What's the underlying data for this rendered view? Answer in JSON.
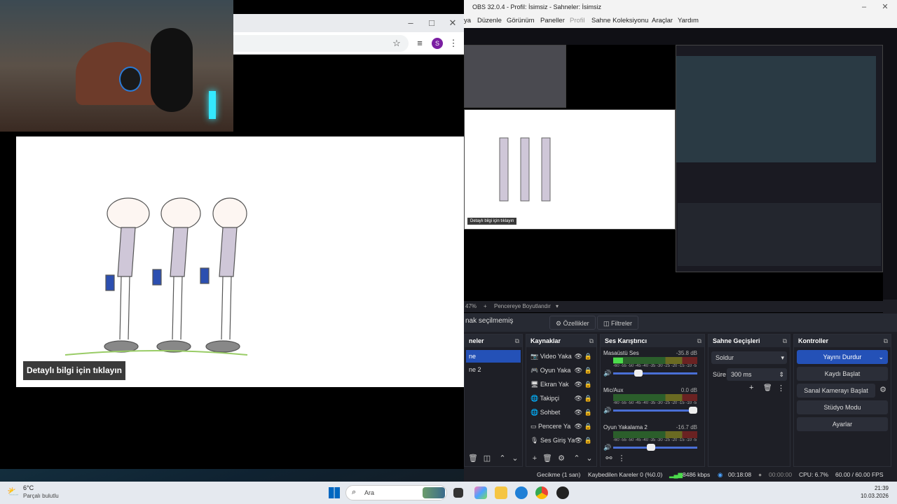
{
  "browser": {
    "toolbar_icons": [
      "star-icon",
      "playlist-icon",
      "menu-icon"
    ],
    "avatar_letter": "S",
    "window_controls": [
      "–",
      "□",
      "✕"
    ],
    "cta": "Detaylı bilgi için tıklayın"
  },
  "obs": {
    "title": "OBS 32.0.4 - Profil: İsimsiz - Sahneler: İsimsiz",
    "menu": [
      "ya",
      "Düzenle",
      "Görünüm",
      "Paneller",
      "Profil",
      "Sahne Koleksiyonu",
      "Araçlar",
      "Yardım"
    ],
    "window_controls": [
      "–",
      "□",
      "✕"
    ],
    "preview_caption": "Detaylı bilgi için tıklayın",
    "zoom": "47%",
    "zoom_mode": "Pencereye Boyutlandır",
    "source_status": "nak seçilmemiş",
    "properties_button": "Özellikler",
    "filters_button": "Filtreler",
    "scenes": {
      "title": "neler",
      "items": [
        "ne",
        "ne 2"
      ]
    },
    "sources": {
      "title": "Kaynaklar",
      "items": [
        {
          "label": "Video Yaka",
          "icon": "camera-icon"
        },
        {
          "label": "Oyun Yaka",
          "icon": "gamepad-icon"
        },
        {
          "label": "Ekran Yak",
          "icon": "monitor-icon"
        },
        {
          "label": "Takipçi",
          "icon": "globe-icon"
        },
        {
          "label": "Sohbet",
          "icon": "globe-icon"
        },
        {
          "label": "Pencere Ya",
          "icon": "window-icon"
        },
        {
          "label": "Ses Giriş Ya",
          "icon": "microphone-icon"
        }
      ]
    },
    "mixer": {
      "title": "Ses Karıştırıcı",
      "ticks": "-60 -55 -50 -45 -40 -35 -30 -25 -20 -15 -10 -5 0",
      "channels": [
        {
          "name": "Masaüstü Ses",
          "db": "-35.8 dB",
          "level": 0.12,
          "volume": 0.3
        },
        {
          "name": "Mic/Aux",
          "db": "0.0 dB",
          "level": 0.0,
          "volume": 0.95
        },
        {
          "name": "Oyun Yakalama 2",
          "db": "-16.7 dB",
          "level": 0.0,
          "volume": 0.45
        }
      ]
    },
    "transitions": {
      "title": "Sahne Geçişleri",
      "selected": "Soldur",
      "duration_label": "Süre",
      "duration": "300 ms"
    },
    "controls": {
      "title": "Kontroller",
      "buttons": [
        "Yayını Durdur",
        "Kaydı Başlat",
        "Sanal Kamerayı Başlat",
        "Stüdyo Modu",
        "Ayarlar"
      ]
    },
    "status": {
      "delay": "Gecikme (1 san)",
      "dropped": "Kaybedilen Kareler 0 (%0.0)",
      "bitrate": "8486 kbps",
      "stream_time": "00:18:08",
      "rec_time": "00:00:00",
      "cpu": "CPU: 6.7%",
      "fps": "60.00 / 60.00 FPS"
    }
  },
  "taskbar": {
    "temperature": "6°C",
    "condition": "Parçalı bulutlu",
    "search_placeholder": "Ara",
    "time": "21:39",
    "date": "10.03.2026"
  }
}
